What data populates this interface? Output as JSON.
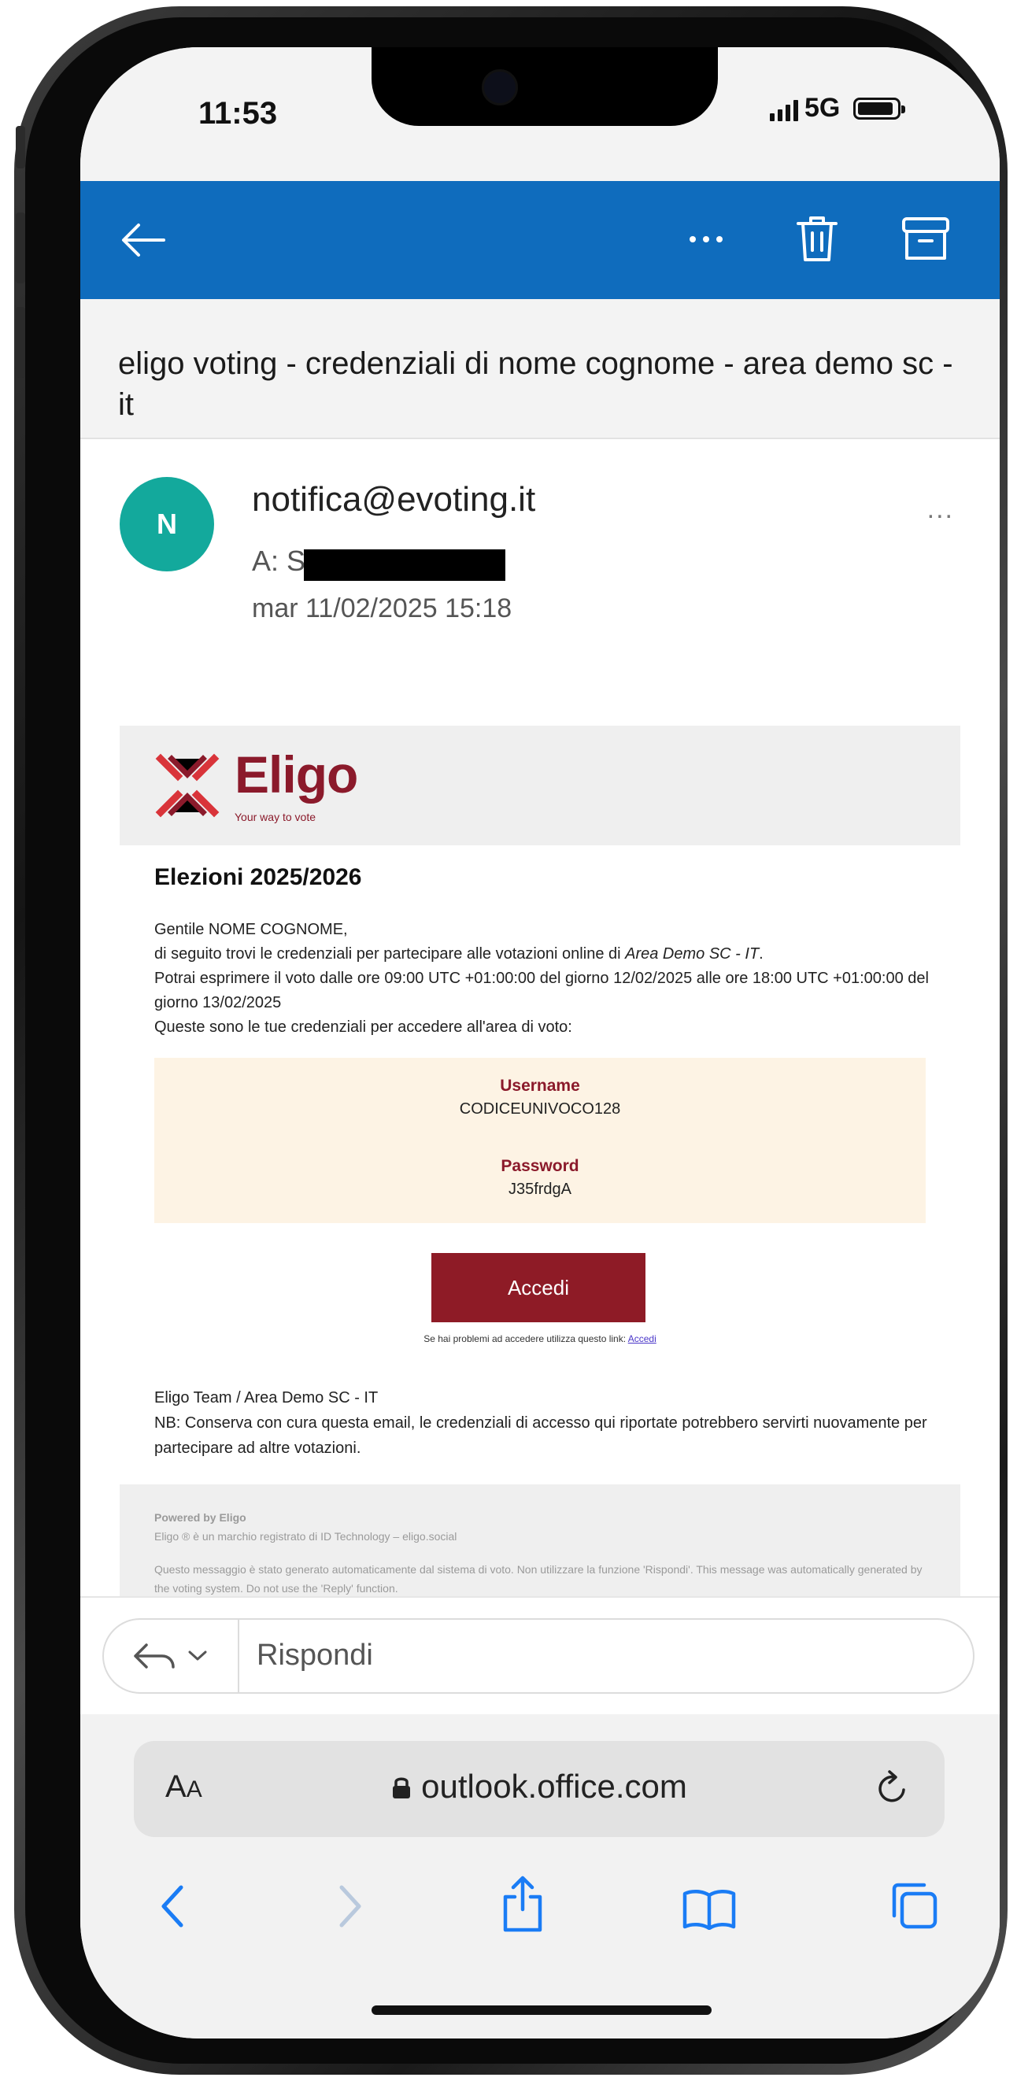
{
  "status_bar": {
    "time": "11:53",
    "network": "5G"
  },
  "toolbar": {
    "back_icon": "arrow-left-icon",
    "more_icon": "ellipsis-icon",
    "delete_icon": "trash-icon",
    "archive_icon": "archive-icon",
    "color": "#0f6cbd"
  },
  "email": {
    "subject": "eligo voting - credenziali di nome cognome - area demo sc - it",
    "avatar_initial": "N",
    "from": "notifica@evoting.it",
    "to_prefix": "A: Sa",
    "date": "mar 11/02/2025 15:18",
    "more_label": "..."
  },
  "body": {
    "logo_text": "Eligo",
    "logo_tagline": "Your way to vote",
    "title": "Elezioni 2025/2026",
    "greeting": "Gentile NOME COGNOME,",
    "line1_pre": "di seguito trovi le credenziali per partecipare alle votazioni online di ",
    "line1_org": "Area Demo SC - IT",
    "line1_post": ".",
    "line2": "Potrai esprimere il voto dalle ore 09:00 UTC +01:00:00 del giorno 12/02/2025 alle ore 18:00 UTC +01:00:00 del giorno 13/02/2025",
    "line3": "Queste sono le tue credenziali per accedere all'area di voto:",
    "username_label": "Username",
    "username_value": "CODICEUNIVOCO128",
    "password_label": "Password",
    "password_value": "J35frdgA",
    "button_label": "Accedi",
    "help_text": "Se hai problemi ad accedere utilizza questo link: ",
    "help_link": "Accedi",
    "sign_line1": "Eligo Team / Area Demo SC - IT",
    "sign_line2": "NB: Conserva con cura questa email, le credenziali di accesso qui riportate potrebbero servirti nuovamente per partecipare ad altre votazioni.",
    "footer_powered": "Powered by Eligo",
    "footer_trademark": "Eligo ® è un marchio registrato di ID Technology – eligo.social",
    "footer_notice": "Questo messaggio è stato generato automaticamente dal sistema di voto. Non utilizzare la funzione 'Rispondi'. This message was automatically generated by the voting system. Do not use the 'Reply' function.",
    "brand_color": "#8e1b26",
    "credentials_bg": "#fdf3e4"
  },
  "reply": {
    "label": "Rispondi",
    "icon": "reply-icon",
    "dropdown_icon": "chevron-down-icon"
  },
  "safari": {
    "aa_label_big": "A",
    "aa_label_small": "A",
    "url": "outlook.office.com",
    "lock_icon": "lock-icon",
    "reload_icon": "reload-icon",
    "nav_icons": [
      "back-icon",
      "forward-icon",
      "share-icon",
      "bookmarks-icon",
      "tabs-icon"
    ]
  }
}
